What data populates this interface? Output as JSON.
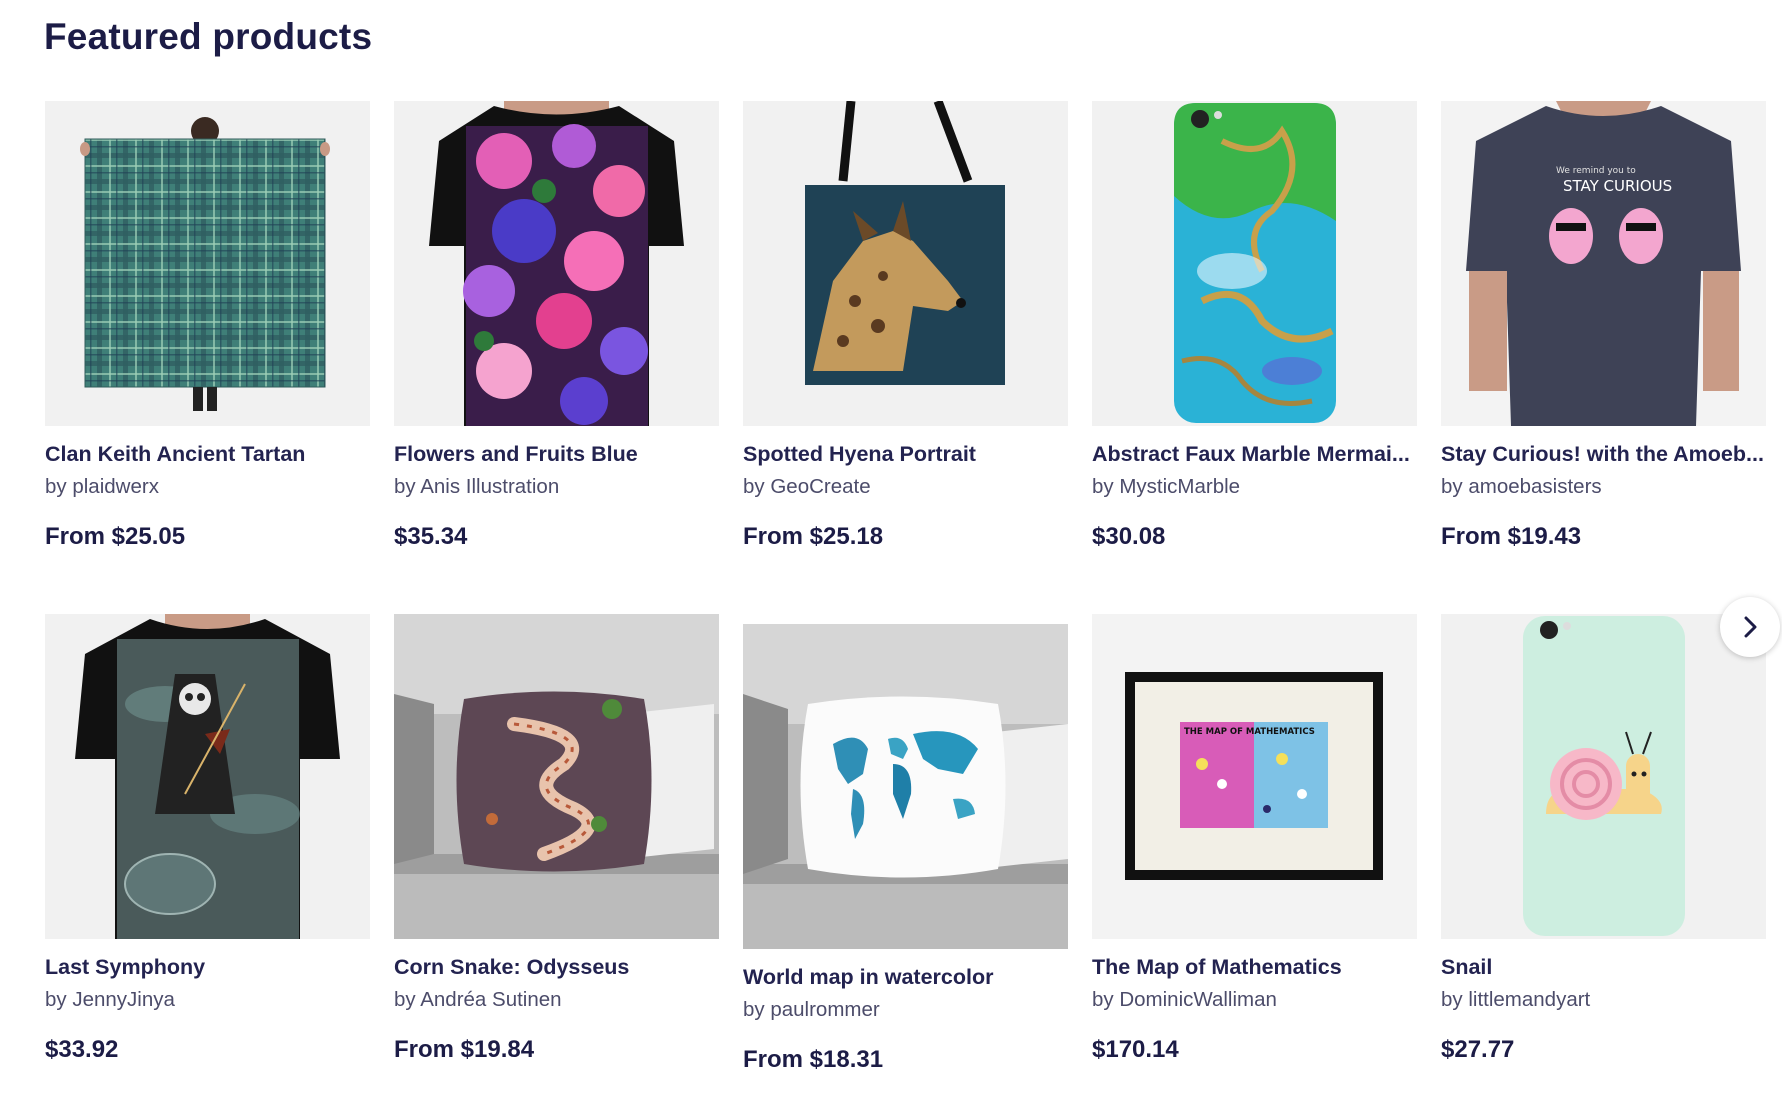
{
  "section": {
    "title": "Featured products"
  },
  "products": [
    {
      "title": "Clan Keith Ancient Tartan",
      "artist": "by plaidwerx",
      "price": "From $25.05"
    },
    {
      "title": "Flowers and Fruits Blue",
      "artist": "by Anis Illustration",
      "price": "$35.34"
    },
    {
      "title": "Spotted Hyena Portrait",
      "artist": "by GeoCreate",
      "price": "From $25.18"
    },
    {
      "title": "Abstract Faux Marble Mermai...",
      "artist": "by MysticMarble",
      "price": "$30.08"
    },
    {
      "title": "Stay Curious! with the Amoeb...",
      "artist": "by amoebasisters",
      "price": "From $19.43"
    },
    {
      "title": "Last Symphony",
      "artist": "by JennyJinya",
      "price": "$33.92"
    },
    {
      "title": "Corn Snake: Odysseus",
      "artist": "by Andréa Sutinen",
      "price": "From $19.84"
    },
    {
      "title": "World map in watercolor",
      "artist": "by paulrommer",
      "price": "From $18.31"
    },
    {
      "title": "The Map of Mathematics",
      "artist": "by DominicWalliman",
      "price": "$170.14"
    },
    {
      "title": "Snail",
      "artist": "by littlemandyart",
      "price": "$27.77"
    }
  ],
  "artwork_text": {
    "curious_small": "We remind you to",
    "curious_big": "STAY CURIOUS",
    "math_map": "THE MAP OF MATHEMATICS"
  },
  "carousel": {
    "next_icon": "chevron-right-icon"
  }
}
